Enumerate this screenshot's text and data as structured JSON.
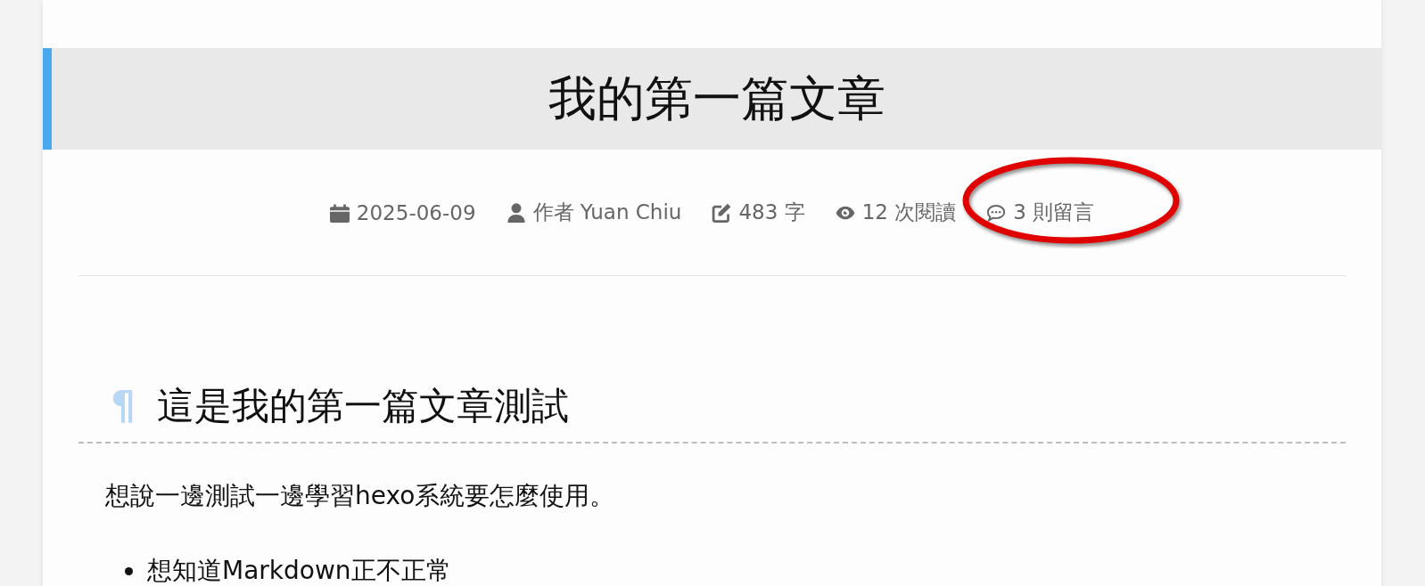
{
  "post": {
    "title": "我的第一篇文章",
    "meta": [
      {
        "kind": "date",
        "text": "2025-06-09",
        "circled": false
      },
      {
        "kind": "author",
        "text": "作者 Yuan Chiu",
        "circled": false
      },
      {
        "kind": "words",
        "text": "483 字",
        "circled": false
      },
      {
        "kind": "views",
        "text": "12 次閱讀",
        "circled": false
      },
      {
        "kind": "comments",
        "text": "3 則留言",
        "circled": true
      }
    ],
    "heading": {
      "anchor": "¶",
      "text": "這是我的第一篇文章測試"
    },
    "paragraph": "想說一邊測試一邊學習hexo系統要怎麼使用。",
    "list": [
      "想知道Markdown正不正常"
    ]
  }
}
